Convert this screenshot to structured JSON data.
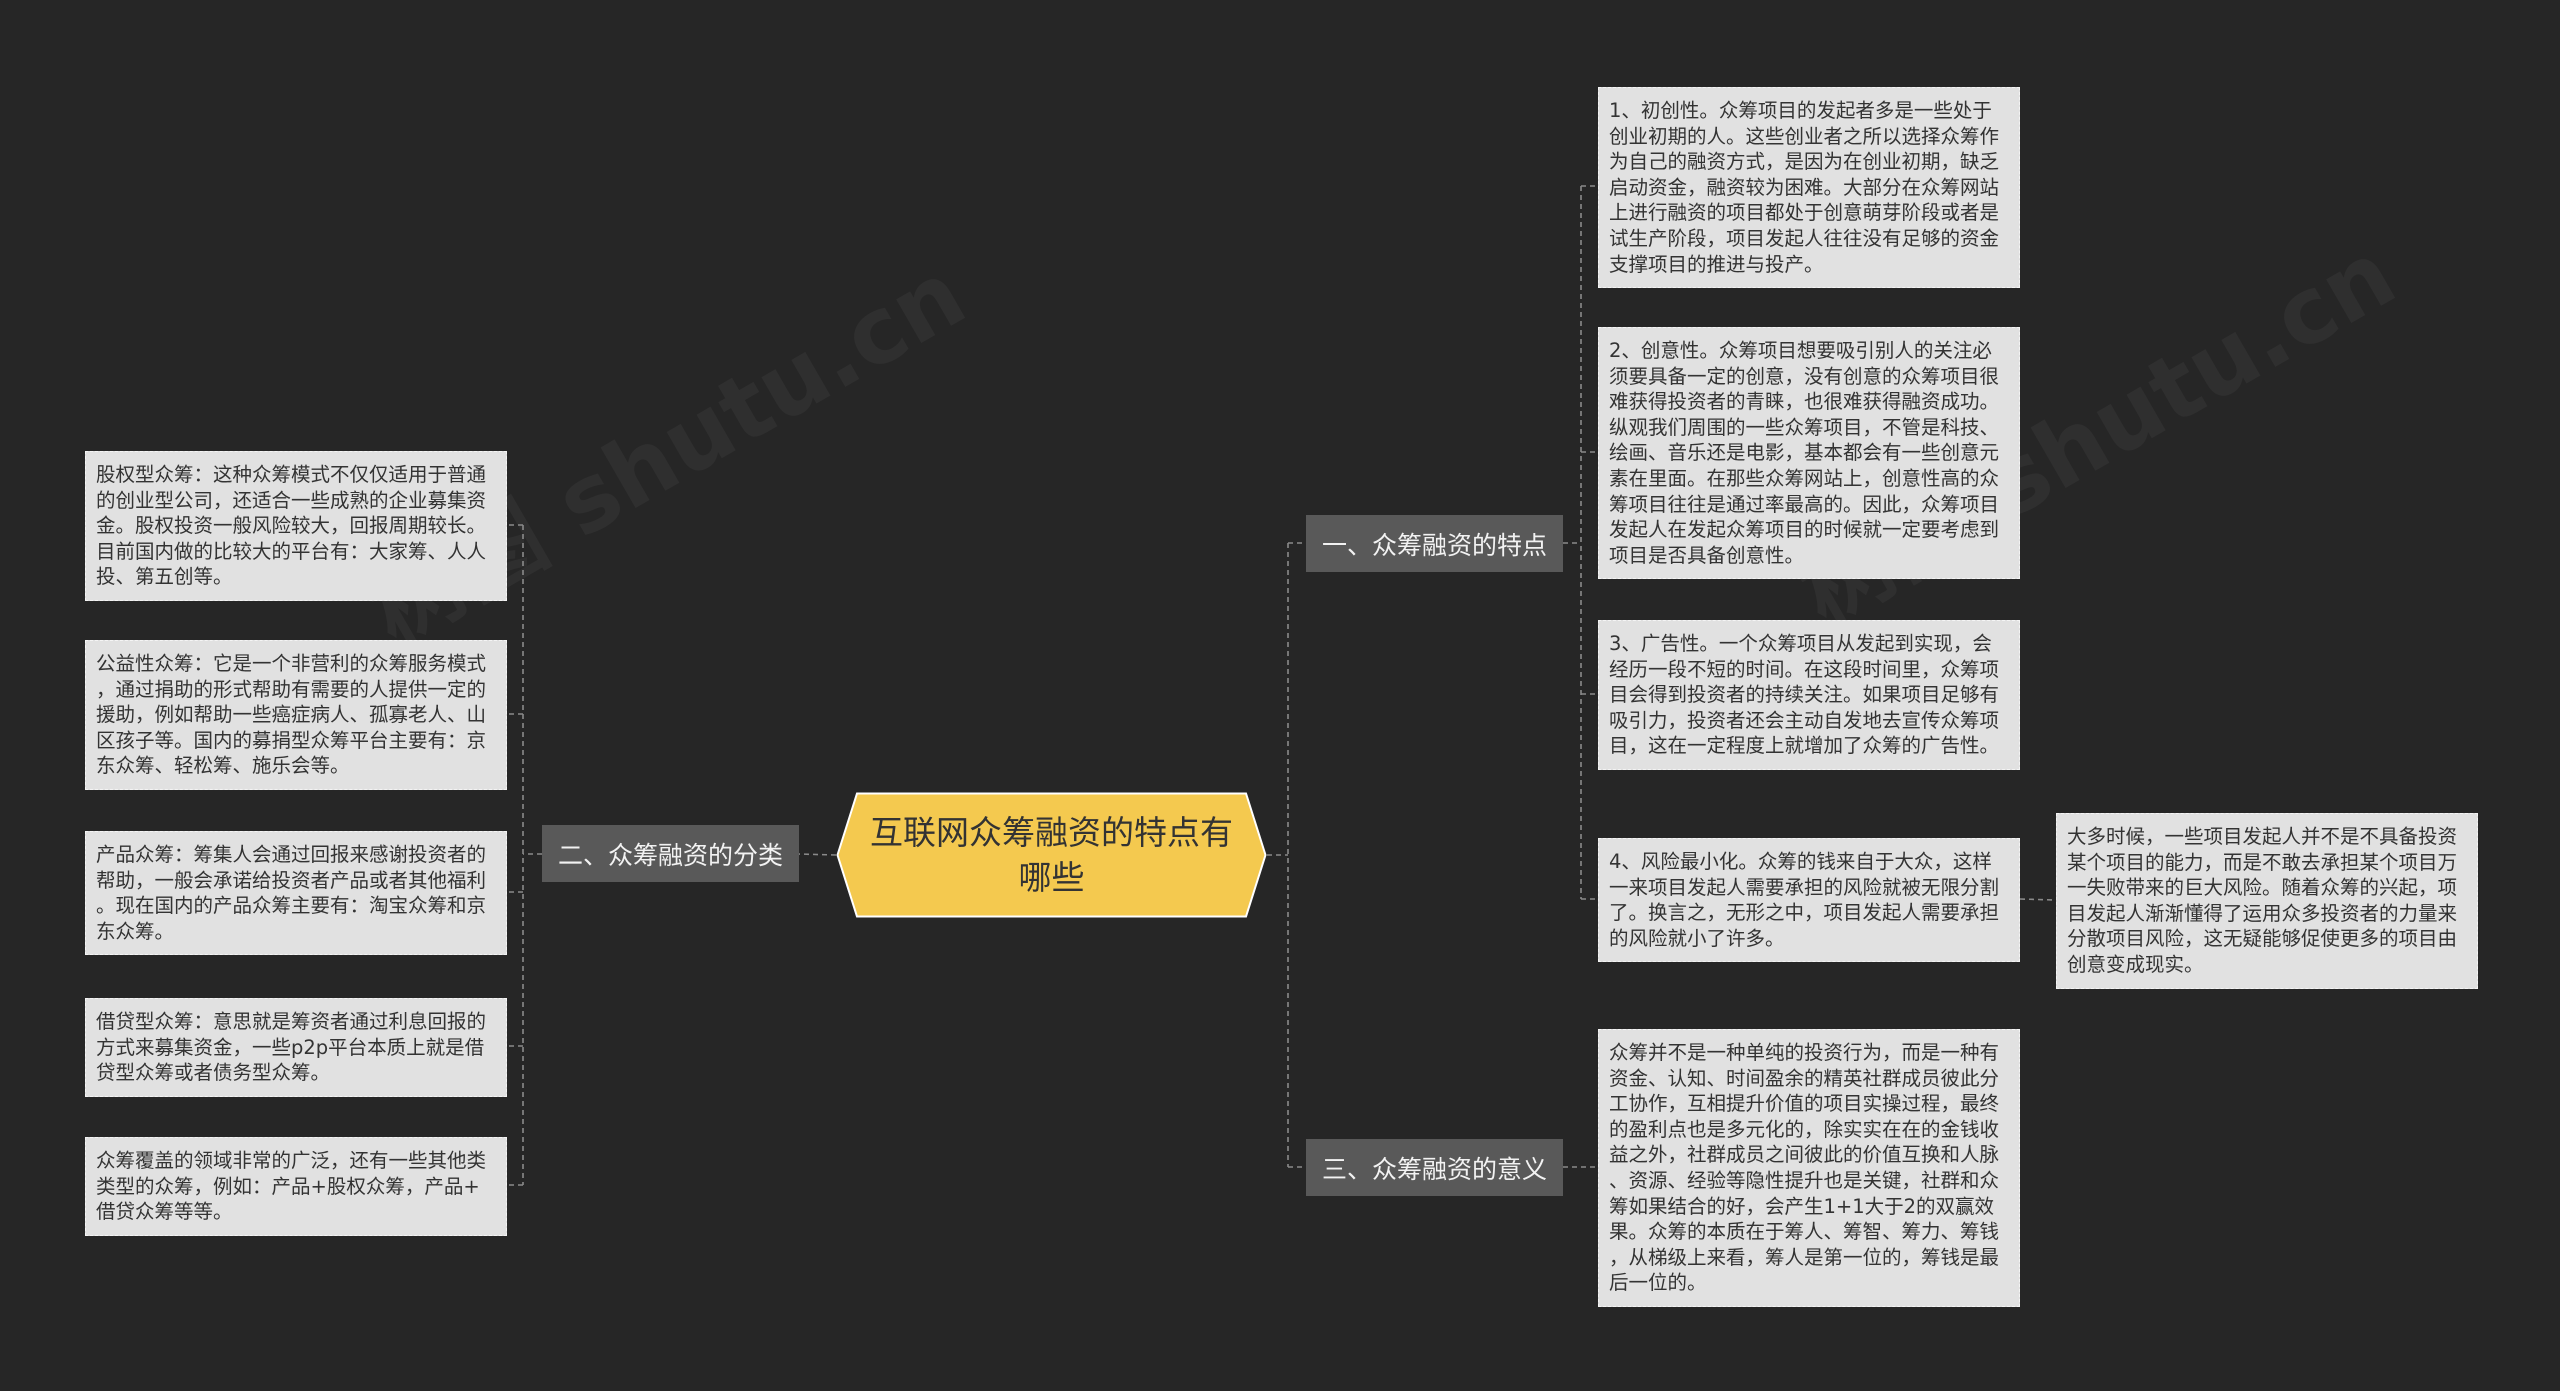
{
  "watermark": "树图 shutu.cn",
  "colors": {
    "background": "#262626",
    "central_fill": "#f4c94f",
    "central_stroke": "#ffffff",
    "branch_fill": "#595959",
    "leaf_fill": "#e1e1e1",
    "connector": "#8a8a8a"
  },
  "central": {
    "title": "互联网众筹融资的特点有哪些"
  },
  "features": {
    "label": "一、众筹融资的特点",
    "items": [
      "1、初创性。众筹项目的发起者多是一些处于创业初期的人。这些创业者之所以选择众筹作为自己的融资方式，是因为在创业初期，缺乏启动资金，融资较为困难。大部分在众筹网站上进行融资的项目都处于创意萌芽阶段或者是试生产阶段，项目发起人往往没有足够的资金支撑项目的推进与投产。",
      "2、创意性。众筹项目想要吸引别人的关注必须要具备一定的创意，没有创意的众筹项目很难获得投资者的青睐，也很难获得融资成功。纵观我们周围的一些众筹项目，不管是科技、绘画、音乐还是电影，基本都会有一些创意元素在里面。在那些众筹网站上，创意性高的众筹项目往往是通过率最高的。因此，众筹项目发起人在发起众筹项目的时候就一定要考虑到项目是否具备创意性。",
      "3、广告性。一个众筹项目从发起到实现，会经历一段不短的时间。在这段时间里，众筹项目会得到投资者的持续关注。如果项目足够有吸引力，投资者还会主动自发地去宣传众筹项目，这在一定程度上就增加了众筹的广告性。",
      "4、风险最小化。众筹的钱来自于大众，这样一来项目发起人需要承担的风险就被无限分割了。换言之，无形之中，项目发起人需要承担的风险就小了许多。"
    ],
    "item4_child": "大多时候，一些项目发起人并不是不具备投资某个项目的能力，而是不敢去承担某个项目万一失败带来的巨大风险。随着众筹的兴起，项目发起人渐渐懂得了运用众多投资者的力量来分散项目风险，这无疑能够促使更多的项目由创意变成现实。"
  },
  "types": {
    "label": "二、众筹融资的分类",
    "items": [
      "股权型众筹：这种众筹模式不仅仅适用于普通的创业型公司，还适合一些成熟的企业募集资金。股权投资一般风险较大，回报周期较长。目前国内做的比较大的平台有：大家筹、人人投、第五创等。",
      "公益性众筹：它是一个非营利的众筹服务模式，通过捐助的形式帮助有需要的人提供一定的援助，例如帮助一些癌症病人、孤寡老人、山区孩子等。国内的募捐型众筹平台主要有：京东众筹、轻松筹、施乐会等。",
      "产品众筹：筹集人会通过回报来感谢投资者的帮助，一般会承诺给投资者产品或者其他福利。现在国内的产品众筹主要有：淘宝众筹和京东众筹。",
      "借贷型众筹：意思就是筹资者通过利息回报的方式来募集资金，一些p2p平台本质上就是借贷型众筹或者债务型众筹。",
      "众筹覆盖的领域非常的广泛，还有一些其他类类型的众筹，例如：产品+股权众筹，产品+借贷众筹等等。"
    ]
  },
  "meaning": {
    "label": "三、众筹融资的意义",
    "items": [
      "众筹并不是一种单纯的投资行为，而是一种有资金、认知、时间盈余的精英社群成员彼此分工协作，互相提升价值的项目实操过程，最终的盈利点也是多元化的，除实实在在的金钱收益之外，社群成员之间彼此的价值互换和人脉、资源、经验等隐性提升也是关键，社群和众筹如果结合的好，会产生1+1大于2的双赢效果。众筹的本质在于筹人、筹智、筹力、筹钱，从梯级上来看，筹人是第一位的，筹钱是最后一位的。"
    ]
  }
}
